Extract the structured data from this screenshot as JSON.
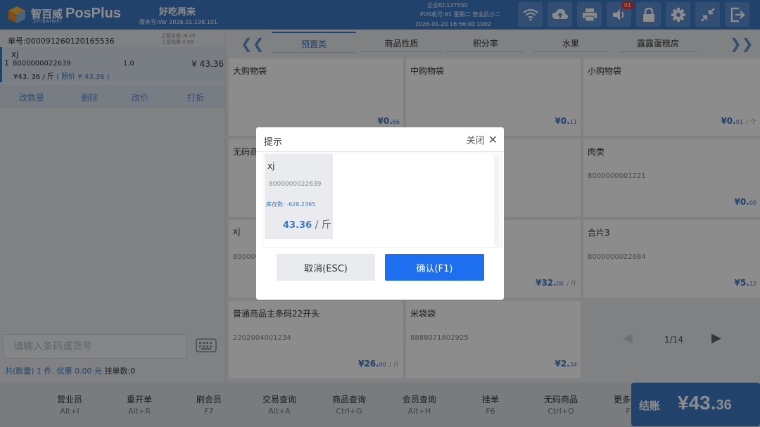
{
  "header": {
    "logo_cn": "智百威",
    "logo_en": "ZHIBAIWEI",
    "app_name": "PosPlus",
    "store_name": "好吃再来",
    "version": "版本号:Ver 2026.01.198.101",
    "company_id": "企业ID:137550",
    "pos_line": "POS机号:91  星期二  营业员小二",
    "datetime_line": "2026-01-20 16:56:00  1002",
    "notification_count": "91",
    "icons": [
      "wifi-icon",
      "cloud-upload-icon",
      "printer-icon",
      "speaker-icon",
      "lock-icon",
      "gear-icon",
      "shrink-icon",
      "logout-icon"
    ],
    "accent_color": "#3d79c2"
  },
  "order": {
    "order_no": "单号:000091260120165536",
    "shift_line1": "上班实收:-8.20",
    "shift_line2": "上班找零:0.00",
    "items": [
      {
        "index": "1",
        "name": "xj",
        "code": "8000000022639",
        "qty": "1.0",
        "total": "¥ 43.36",
        "price": "¥43. 36 / 斤",
        "ref_price": "( 照价 ¥ 43.36 )"
      }
    ],
    "actions": [
      "改数量",
      "删除",
      "改价",
      "打折"
    ],
    "search_placeholder": "请输入条码或货号",
    "summary": "共(数量) 1 件, 优惠 0.00 元",
    "hold_count": "挂单数:0"
  },
  "categories": {
    "prev_label": "❮❮",
    "next_label": "❯❯",
    "items": [
      "预置类",
      "商品性质",
      "积分率",
      "水果",
      "露露蛋糕房"
    ],
    "active_index": 0
  },
  "products": [
    {
      "name": "大购物袋",
      "code": "",
      "price_main": "¥0.",
      "price_dec": "66",
      "unit": ""
    },
    {
      "name": "中购物袋",
      "code": "",
      "price_main": "¥0.",
      "price_dec": "11",
      "unit": ""
    },
    {
      "name": "小购物袋",
      "code": "",
      "price_main": "¥0.",
      "price_dec": "01",
      "unit": "/ 个"
    },
    {
      "name": "无码商",
      "code": "",
      "price_main": "",
      "price_dec": "",
      "unit": ""
    },
    {
      "name": "",
      "code": "",
      "price_main": "",
      "price_dec": "",
      "unit": ""
    },
    {
      "name": "肉类",
      "code": "8000000001221",
      "price_main": "¥0.",
      "price_dec": "00",
      "unit": ""
    },
    {
      "name": "xj",
      "code": "800000",
      "price_main": "",
      "price_dec": "",
      "unit": ""
    },
    {
      "name": "",
      "code": "",
      "price_main": "¥32.",
      "price_dec": "00",
      "unit": "/ 斤"
    },
    {
      "name": "合片3",
      "code": "8000000022684",
      "price_main": "¥5.",
      "price_dec": "12",
      "unit": ""
    },
    {
      "name": "普通商品主条码22开头",
      "code": "2202004001234",
      "price_main": "¥26.",
      "price_dec": "00",
      "unit": "/ 斤"
    },
    {
      "name": "米袋袋",
      "code": "8888071602925",
      "price_main": "¥2.",
      "price_dec": "34",
      "unit": ""
    }
  ],
  "pager": {
    "text": "1/14"
  },
  "footer": {
    "buttons": [
      {
        "label": "营业员",
        "key": "Alt+I"
      },
      {
        "label": "重开单",
        "key": "Alt+R"
      },
      {
        "label": "刷会员",
        "key": "F7"
      },
      {
        "label": "交易查询",
        "key": "Alt+A"
      },
      {
        "label": "商品查询",
        "key": "Ctrl+G"
      },
      {
        "label": "会员查询",
        "key": "Alt+H"
      },
      {
        "label": "挂单",
        "key": "F6"
      },
      {
        "label": "无码商品",
        "key": "Ctrl+O"
      },
      {
        "label": "更多功能",
        "key": "F1"
      }
    ],
    "checkout_label": "结账",
    "checkout_amount_main": "¥43.",
    "checkout_amount_dec": "36"
  },
  "dialog": {
    "title": "提示",
    "close_label": "关闭",
    "product": {
      "name": "xj",
      "code": "8000000022639",
      "stock": "库存数: -628.2365",
      "price": "43.36",
      "unit": "/ 斤"
    },
    "cancel_label": "取消(ESC)",
    "confirm_label": "确认(F1)"
  }
}
